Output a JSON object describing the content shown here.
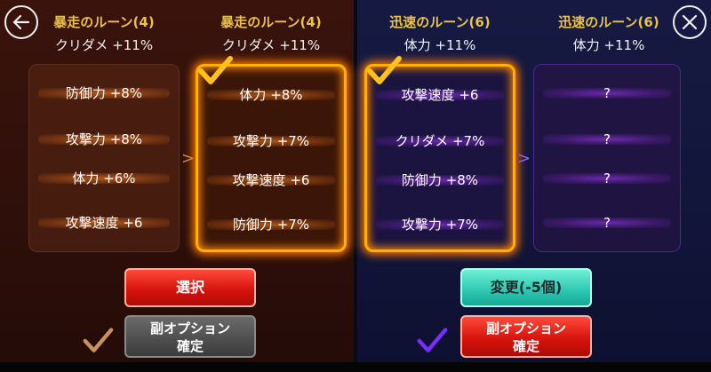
{
  "left": {
    "current": {
      "title": "暴走のルーン(4)",
      "subtitle": "クリダメ +11%",
      "stats": [
        "防御力 +8%",
        "攻撃力 +8%",
        "体力 +6%",
        "攻撃速度 +6"
      ]
    },
    "new": {
      "title": "暴走のルーン(4)",
      "subtitle": "クリダメ +11%",
      "stats": [
        "体力 +8%",
        "攻撃力 +7%",
        "攻撃速度 +6",
        "防御力 +7%"
      ]
    },
    "arrow": ">",
    "select_button": "選択",
    "confirm_button_line1": "副オプション",
    "confirm_button_line2": "確定"
  },
  "right": {
    "current": {
      "title": "迅速のルーン(6)",
      "subtitle": "体力 +11%",
      "stats": [
        "攻撃速度 +6",
        "クリダメ +7%",
        "防御力 +8%",
        "攻撃力 +7%"
      ]
    },
    "new": {
      "title": "迅速のルーン(6)",
      "subtitle": "体力 +11%",
      "stats": [
        "?",
        "?",
        "?",
        "?"
      ]
    },
    "arrow": ">",
    "change_button": "変更(-5個)",
    "confirm_button_line1": "副オプション",
    "confirm_button_line2": "確定"
  },
  "colors": {
    "gold_title": "#e8c24a",
    "selected_border": "#ffb000",
    "left_check": "#c8935a",
    "right_check": "#7b2cff",
    "red_button": "#d8140e",
    "teal_button": "#2cc6b0"
  },
  "icons": {
    "back": "back-arrow-icon",
    "close": "close-x-icon",
    "check": "checkmark-icon"
  }
}
